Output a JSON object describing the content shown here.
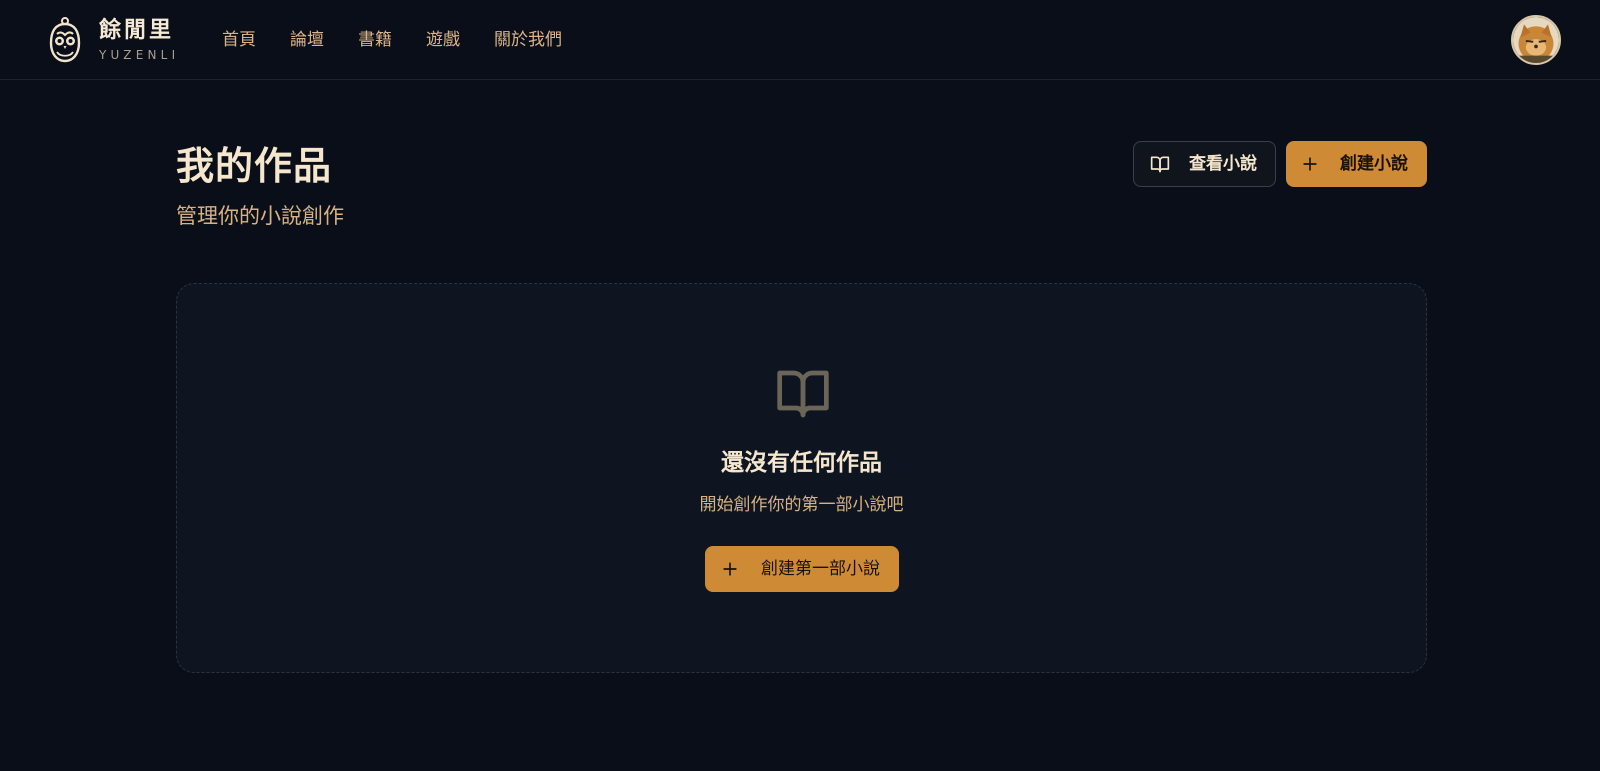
{
  "header": {
    "brand_name": "餘閒里",
    "brand_sub": "YUZENLI",
    "nav": [
      "首頁",
      "論壇",
      "書籍",
      "遊戲",
      "關於我們"
    ]
  },
  "page": {
    "title": "我的作品",
    "subtitle": "管理你的小說創作",
    "view_button": "查看小說",
    "create_button": "創建小說"
  },
  "empty_state": {
    "title": "還沒有任何作品",
    "description": "開始創作你的第一部小說吧",
    "button": "創建第一部小說"
  },
  "icons": {
    "logo": "owl-logo-icon",
    "view": "book-open-icon",
    "create": "plus-icon",
    "empty": "book-open-icon",
    "avatar": "user-avatar"
  },
  "colors": {
    "background": "#0a0e18",
    "accent": "#cf8a35",
    "card": "#0e1520",
    "text_primary": "#f5e6cd",
    "text_secondary": "#d7b384"
  }
}
